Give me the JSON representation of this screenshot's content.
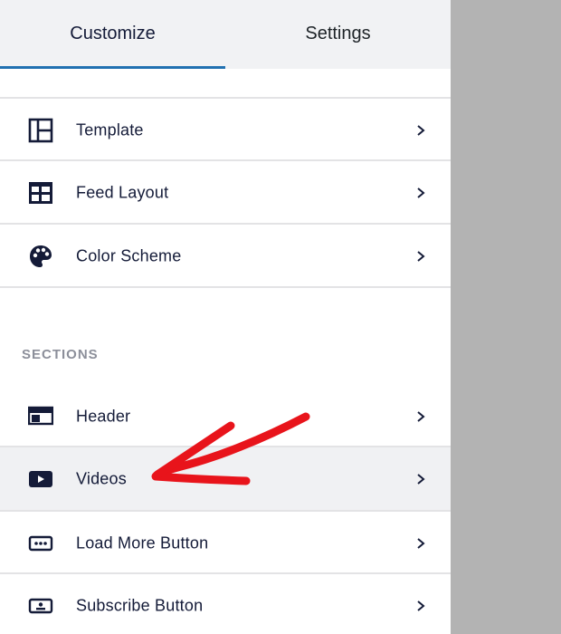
{
  "tabs": [
    {
      "label": "Customize",
      "active": true
    },
    {
      "label": "Settings",
      "active": false
    }
  ],
  "general_items": [
    {
      "label": "Template",
      "icon": "template-icon"
    },
    {
      "label": "Feed Layout",
      "icon": "grid-layout-icon"
    },
    {
      "label": "Color Scheme",
      "icon": "palette-icon"
    }
  ],
  "sections": {
    "title": "SECTIONS",
    "items": [
      {
        "label": "Header",
        "icon": "header-icon"
      },
      {
        "label": "Videos",
        "icon": "video-play-icon",
        "highlighted": true
      },
      {
        "label": "Load More Button",
        "icon": "load-more-icon"
      },
      {
        "label": "Subscribe Button",
        "icon": "subscribe-icon"
      }
    ]
  },
  "colors": {
    "accent": "#2271b1",
    "text": "#141b38",
    "annotation_arrow": "#e8141b"
  }
}
